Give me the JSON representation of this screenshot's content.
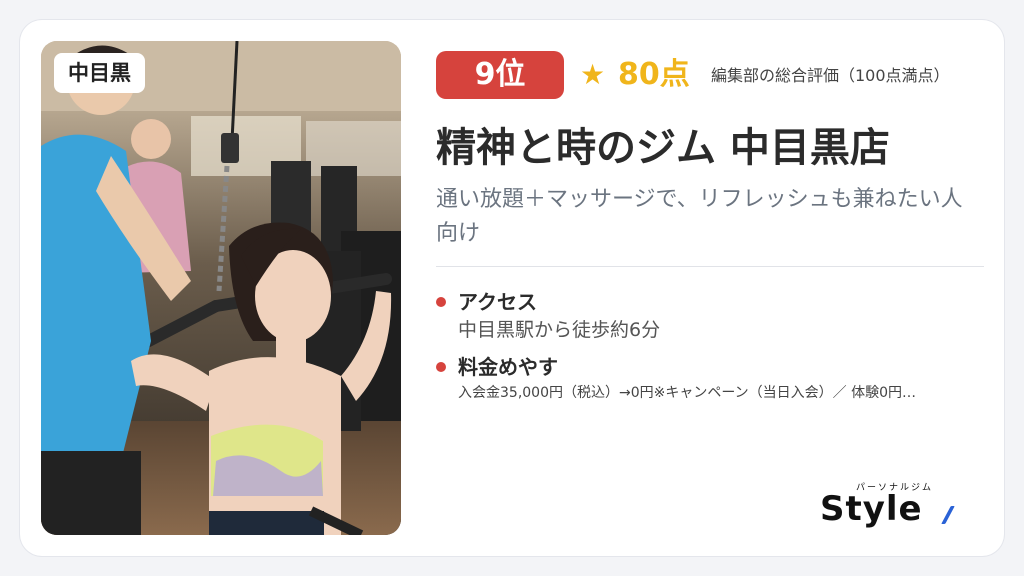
{
  "area": "中目黒",
  "ranking": {
    "rank": "9位",
    "star": "★",
    "score": "80点",
    "score_note": "編集部の総合評価（100点満点）"
  },
  "gym_name": "精神と時のジム 中目黒店",
  "catchcopy": "通い放題＋マッサージで、リフレッシュも兼ねたい人向け",
  "info": [
    {
      "label": "アクセス",
      "value": "中目黒駅から徒歩約6分"
    },
    {
      "label": "料金めやす",
      "value": "入会金35,000円（税込）→0円※キャンペーン（当日入会）／ 体験0円…"
    }
  ],
  "logo": {
    "kana": "パーソナルジム",
    "text": "Style"
  },
  "colors": {
    "accent_red": "#d6433d",
    "star_yellow": "#f0b51b",
    "logo_blue": "#2a62d6"
  },
  "photo": {
    "icon": "gym-training-photo"
  }
}
